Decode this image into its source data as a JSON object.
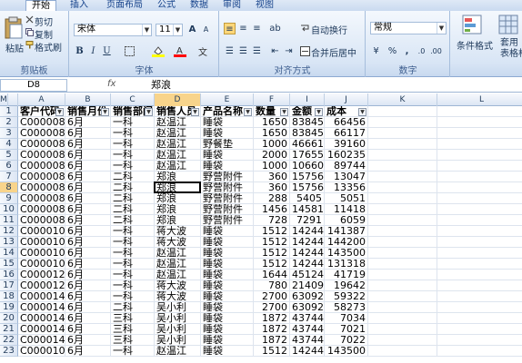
{
  "ribbon": {
    "tabs": [
      "开始",
      "插入",
      "页面布局",
      "公式",
      "数据",
      "审阅",
      "视图"
    ],
    "clipboard": {
      "paste": "粘贴",
      "cut": "剪切",
      "copy": "复制",
      "format_painter": "格式刷",
      "label": "剪贴板"
    },
    "font": {
      "name": "宋体",
      "size": "11",
      "label": "字体"
    },
    "alignment": {
      "wrap": "自动换行",
      "merge": "合并后居中",
      "label": "对齐方式"
    },
    "number": {
      "format": "常规",
      "label": "数字"
    },
    "styles": {
      "conditional": "条件格式",
      "table": "套用\n表格格式"
    }
  },
  "formula_bar": {
    "name_box": "D8",
    "fx": "fx",
    "value": "郑浪"
  },
  "columns": [
    "A",
    "B",
    "C",
    "D",
    "E",
    "F",
    "I",
    "J",
    "K",
    "L",
    "M"
  ],
  "selected_column": "D",
  "selected_row": 8,
  "header_row": [
    "客户代码",
    "销售月份",
    "销售部门",
    "销售人员",
    "产品名称",
    "数量",
    "金额",
    "成本"
  ],
  "rows": [
    [
      "C000008",
      "6月",
      "一科",
      "赵温江",
      "睡袋",
      "1650",
      "83845",
      "66456"
    ],
    [
      "C000008",
      "6月",
      "一科",
      "赵温江",
      "睡袋",
      "1650",
      "83845",
      "66117"
    ],
    [
      "C000008",
      "6月",
      "一科",
      "赵温江",
      "野餐垫",
      "1000",
      "46661",
      "39160"
    ],
    [
      "C000008",
      "6月",
      "一科",
      "赵温江",
      "睡袋",
      "2000",
      "176555",
      "160235"
    ],
    [
      "C000008",
      "6月",
      "一科",
      "赵温江",
      "睡袋",
      "1000",
      "106600",
      "89744"
    ],
    [
      "C000008",
      "6月",
      "二科",
      "郑浪",
      "野营附件",
      "360",
      "15756",
      "13047"
    ],
    [
      "C000008",
      "6月",
      "二科",
      "郑浪",
      "野营附件",
      "360",
      "15756",
      "13356"
    ],
    [
      "C000008",
      "6月",
      "二科",
      "郑浪",
      "野营附件",
      "288",
      "5405",
      "5051"
    ],
    [
      "C000008",
      "6月",
      "二科",
      "郑浪",
      "野营附件",
      "1456",
      "14581",
      "11418"
    ],
    [
      "C000008",
      "6月",
      "二科",
      "郑浪",
      "野营附件",
      "728",
      "7291",
      "6059"
    ],
    [
      "C000010",
      "6月",
      "一科",
      "蒋大波",
      "睡袋",
      "1512",
      "142448",
      "141387"
    ],
    [
      "C000010",
      "6月",
      "一科",
      "蒋大波",
      "睡袋",
      "1512",
      "142448",
      "144200"
    ],
    [
      "C000010",
      "6月",
      "一科",
      "赵温江",
      "睡袋",
      "1512",
      "142448",
      "143500"
    ],
    [
      "C000010",
      "6月",
      "一科",
      "赵温江",
      "睡袋",
      "1512",
      "142448",
      "131318"
    ],
    [
      "C000012",
      "6月",
      "一科",
      "赵温江",
      "睡袋",
      "1644",
      "45124",
      "41719"
    ],
    [
      "C000012",
      "6月",
      "一科",
      "蒋大波",
      "睡袋",
      "780",
      "21409",
      "19642"
    ],
    [
      "C000014",
      "6月",
      "一科",
      "蒋大波",
      "睡袋",
      "2700",
      "63092",
      "59322"
    ],
    [
      "C000014",
      "6月",
      "二科",
      "吴小利",
      "睡袋",
      "2700",
      "63092",
      "58273"
    ],
    [
      "C000014",
      "6月",
      "三科",
      "吴小利",
      "睡袋",
      "1872",
      "43744",
      "7034"
    ],
    [
      "C000014",
      "6月",
      "三科",
      "吴小利",
      "睡袋",
      "1872",
      "43744",
      "7021"
    ],
    [
      "C000014",
      "6月",
      "三科",
      "吴小利",
      "睡袋",
      "1872",
      "43744",
      "7022"
    ],
    [
      "C000010",
      "6月",
      "一科",
      "赵温江",
      "睡袋",
      "1512",
      "142448",
      "143500"
    ]
  ]
}
